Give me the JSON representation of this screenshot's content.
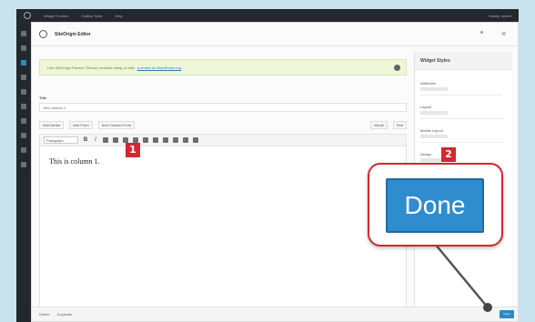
{
  "wp_admin_bar": {
    "items": [
      "Widget Context",
      "Gallery Tools",
      "Help"
    ],
    "user": "Howdy, admin"
  },
  "modal": {
    "title": "SiteOrigin Editor",
    "notice_text": "Like SiteOrigin Panels? Please consider rating us with",
    "notice_link": "a review on WordPress.org",
    "title_label": "Title",
    "title_value": "Box column 1",
    "toolbar1": [
      "Add Media",
      "Add Form",
      "Add Contact Form"
    ],
    "view_tabs": [
      "Visual",
      "Text"
    ],
    "format_select": "Paragraph",
    "content_text": "This is column 1."
  },
  "sidebar": {
    "header": "Widget Styles",
    "rows": [
      "Attributes",
      "Layout",
      "Mobile Layout",
      "Design"
    ]
  },
  "footer": {
    "delete_label": "Delete",
    "duplicate_label": "Duplicate",
    "small_done_label": "Done"
  },
  "callout": {
    "done_label": "Done"
  },
  "badges": {
    "one": "1",
    "two": "2"
  },
  "colors": {
    "accent_blue": "#2f8ccf",
    "badge_red": "#d6262f"
  }
}
